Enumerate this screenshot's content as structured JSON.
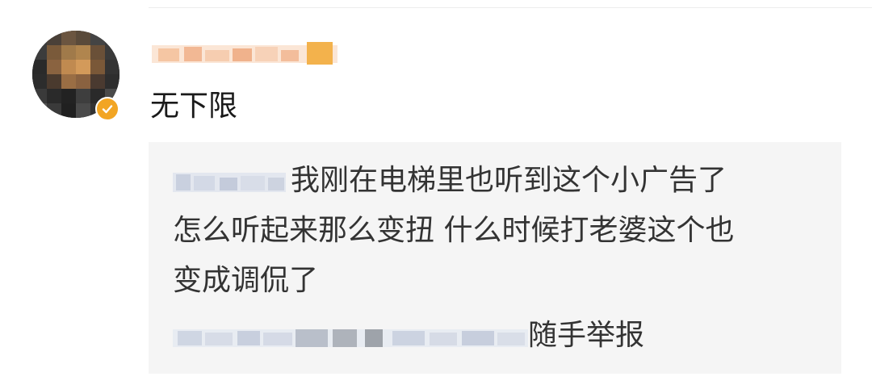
{
  "comment": {
    "avatar_icon": "avatar",
    "badge_icon": "verified-check-icon",
    "badge_color": "#f2a523",
    "text": "无下限"
  },
  "reply": {
    "line1": "我刚在电梯里也听到这个小广告了",
    "line2": "怎么听起来那么变扭 什么时候打老婆这个也",
    "line3": "变成调侃了"
  },
  "footer": {
    "report_label": "随手举报"
  }
}
